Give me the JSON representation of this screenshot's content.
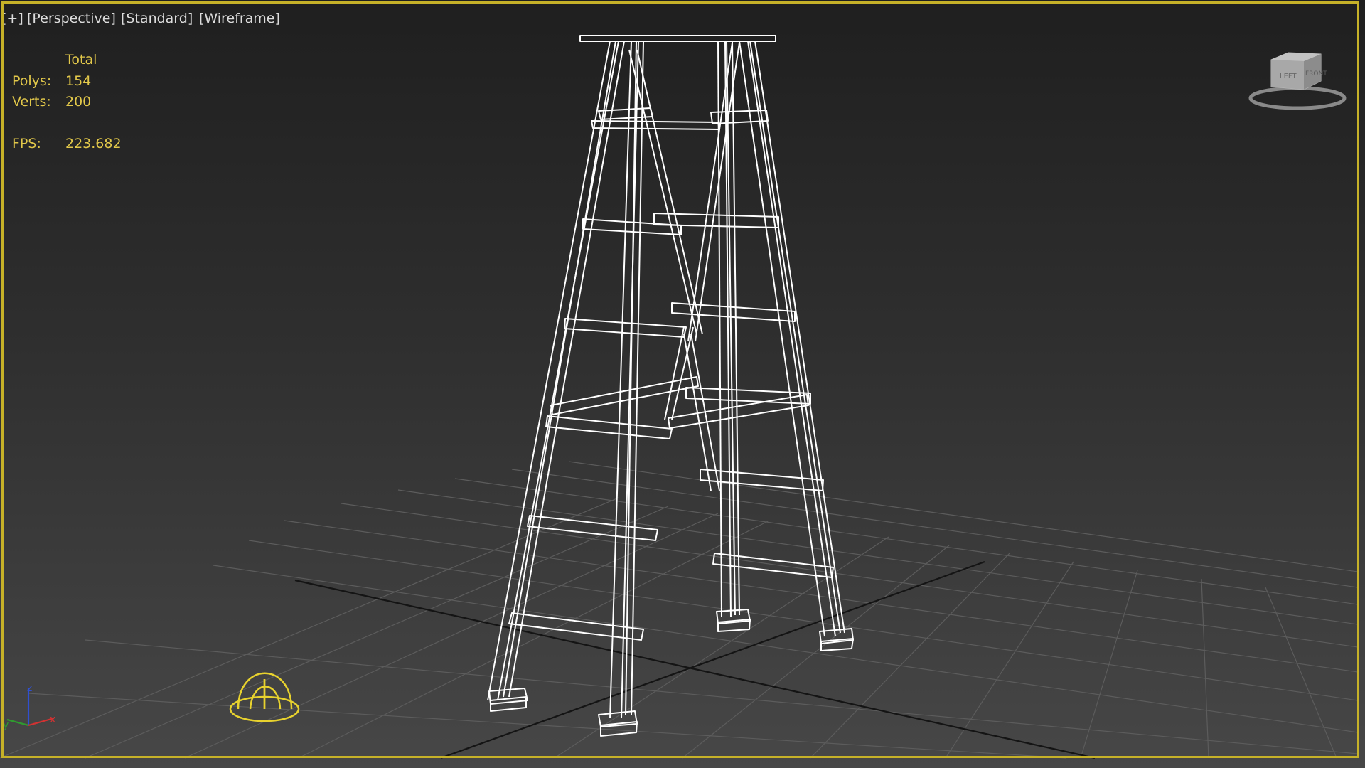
{
  "viewport": {
    "labels": {
      "plus": "[+]",
      "view": "[Perspective]",
      "shading_standard": "[Standard]",
      "shading_mode": "[Wireframe]"
    },
    "stats": {
      "header": "Total",
      "polys_label": "Polys:",
      "polys_value": "154",
      "verts_label": "Verts:",
      "verts_value": "200",
      "fps_label": "FPS:",
      "fps_value": "223.682"
    },
    "viewcube": {
      "face_front": "LEFT",
      "face_right": "FRONT"
    },
    "axis_tripod": {
      "x": "x",
      "y": "y",
      "z": "z"
    }
  },
  "colors": {
    "viewport_border": "#c6b128",
    "stats_text": "#e2c84a",
    "label_text": "#dcdcdc",
    "wireframe": "#ffffff",
    "grid": "#5a5a5a",
    "light_gizmo": "#e8d22e",
    "axis_x": "#d23232",
    "axis_y": "#2f9a2f",
    "axis_z": "#3050d0"
  }
}
